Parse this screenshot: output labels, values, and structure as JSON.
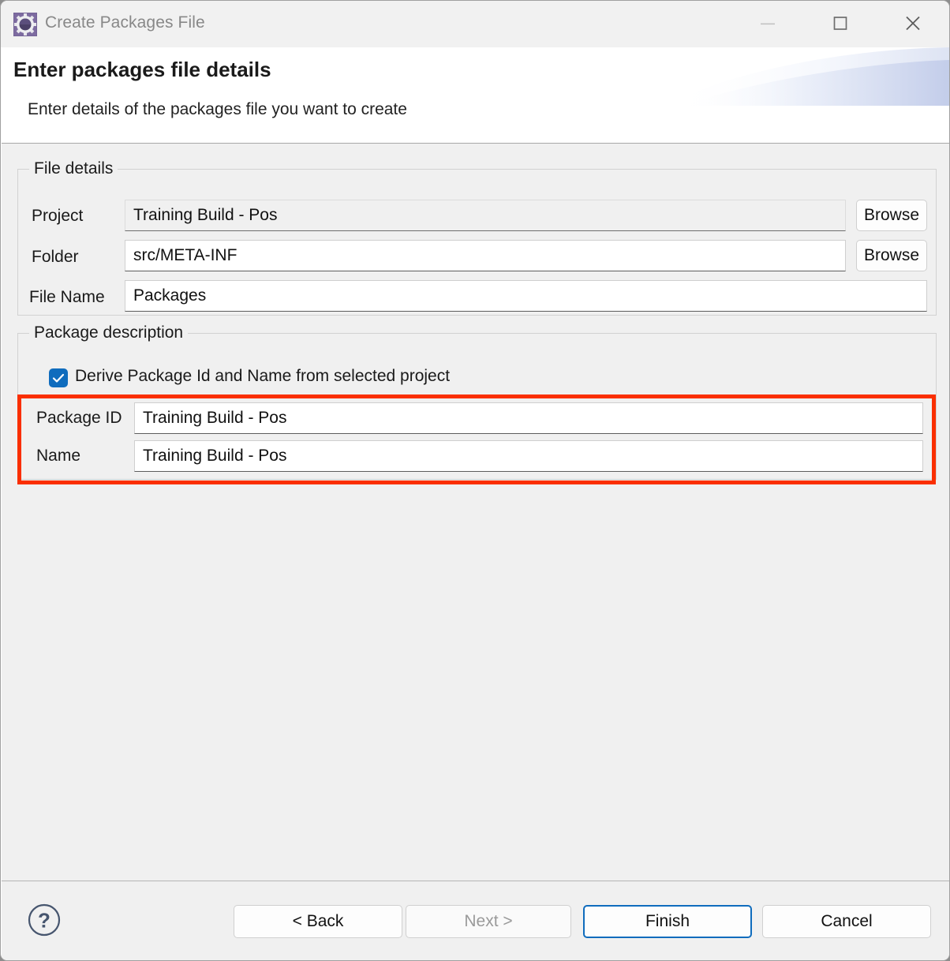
{
  "window": {
    "title": "Create Packages File",
    "icon": "package-gear-icon",
    "controls": {
      "minimize": "minimize-icon",
      "maximize": "maximize-icon",
      "close": "close-icon"
    }
  },
  "header": {
    "title": "Enter packages file details",
    "subtitle": "Enter details of the packages file you want to create"
  },
  "file_details": {
    "legend": "File details",
    "fields": [
      {
        "label": "Project",
        "value": "Training Build - Pos",
        "readonly": true,
        "browse_label": "Browse"
      },
      {
        "label": "Folder",
        "value": "src/META-INF",
        "readonly": false,
        "browse_label": "Browse"
      },
      {
        "label": "File Name",
        "value": "Packages",
        "readonly": false
      }
    ]
  },
  "package_description": {
    "legend": "Package description",
    "derive_checkbox": {
      "label": "Derive Package Id and Name from selected project",
      "checked": true
    },
    "fields": [
      {
        "label": "Package ID",
        "value": "Training Build - Pos"
      },
      {
        "label": "Name",
        "value": "Training Build - Pos"
      }
    ]
  },
  "annotation": {
    "highlight_color": "#fa2f00"
  },
  "footer": {
    "help_icon": "help-question-icon",
    "buttons": {
      "back": "< Back",
      "next": "Next >",
      "finish": "Finish",
      "cancel": "Cancel"
    }
  },
  "colors": {
    "accent": "#0f6cbd",
    "window_bg": "#f0f0f0",
    "title_text": "#888888"
  }
}
